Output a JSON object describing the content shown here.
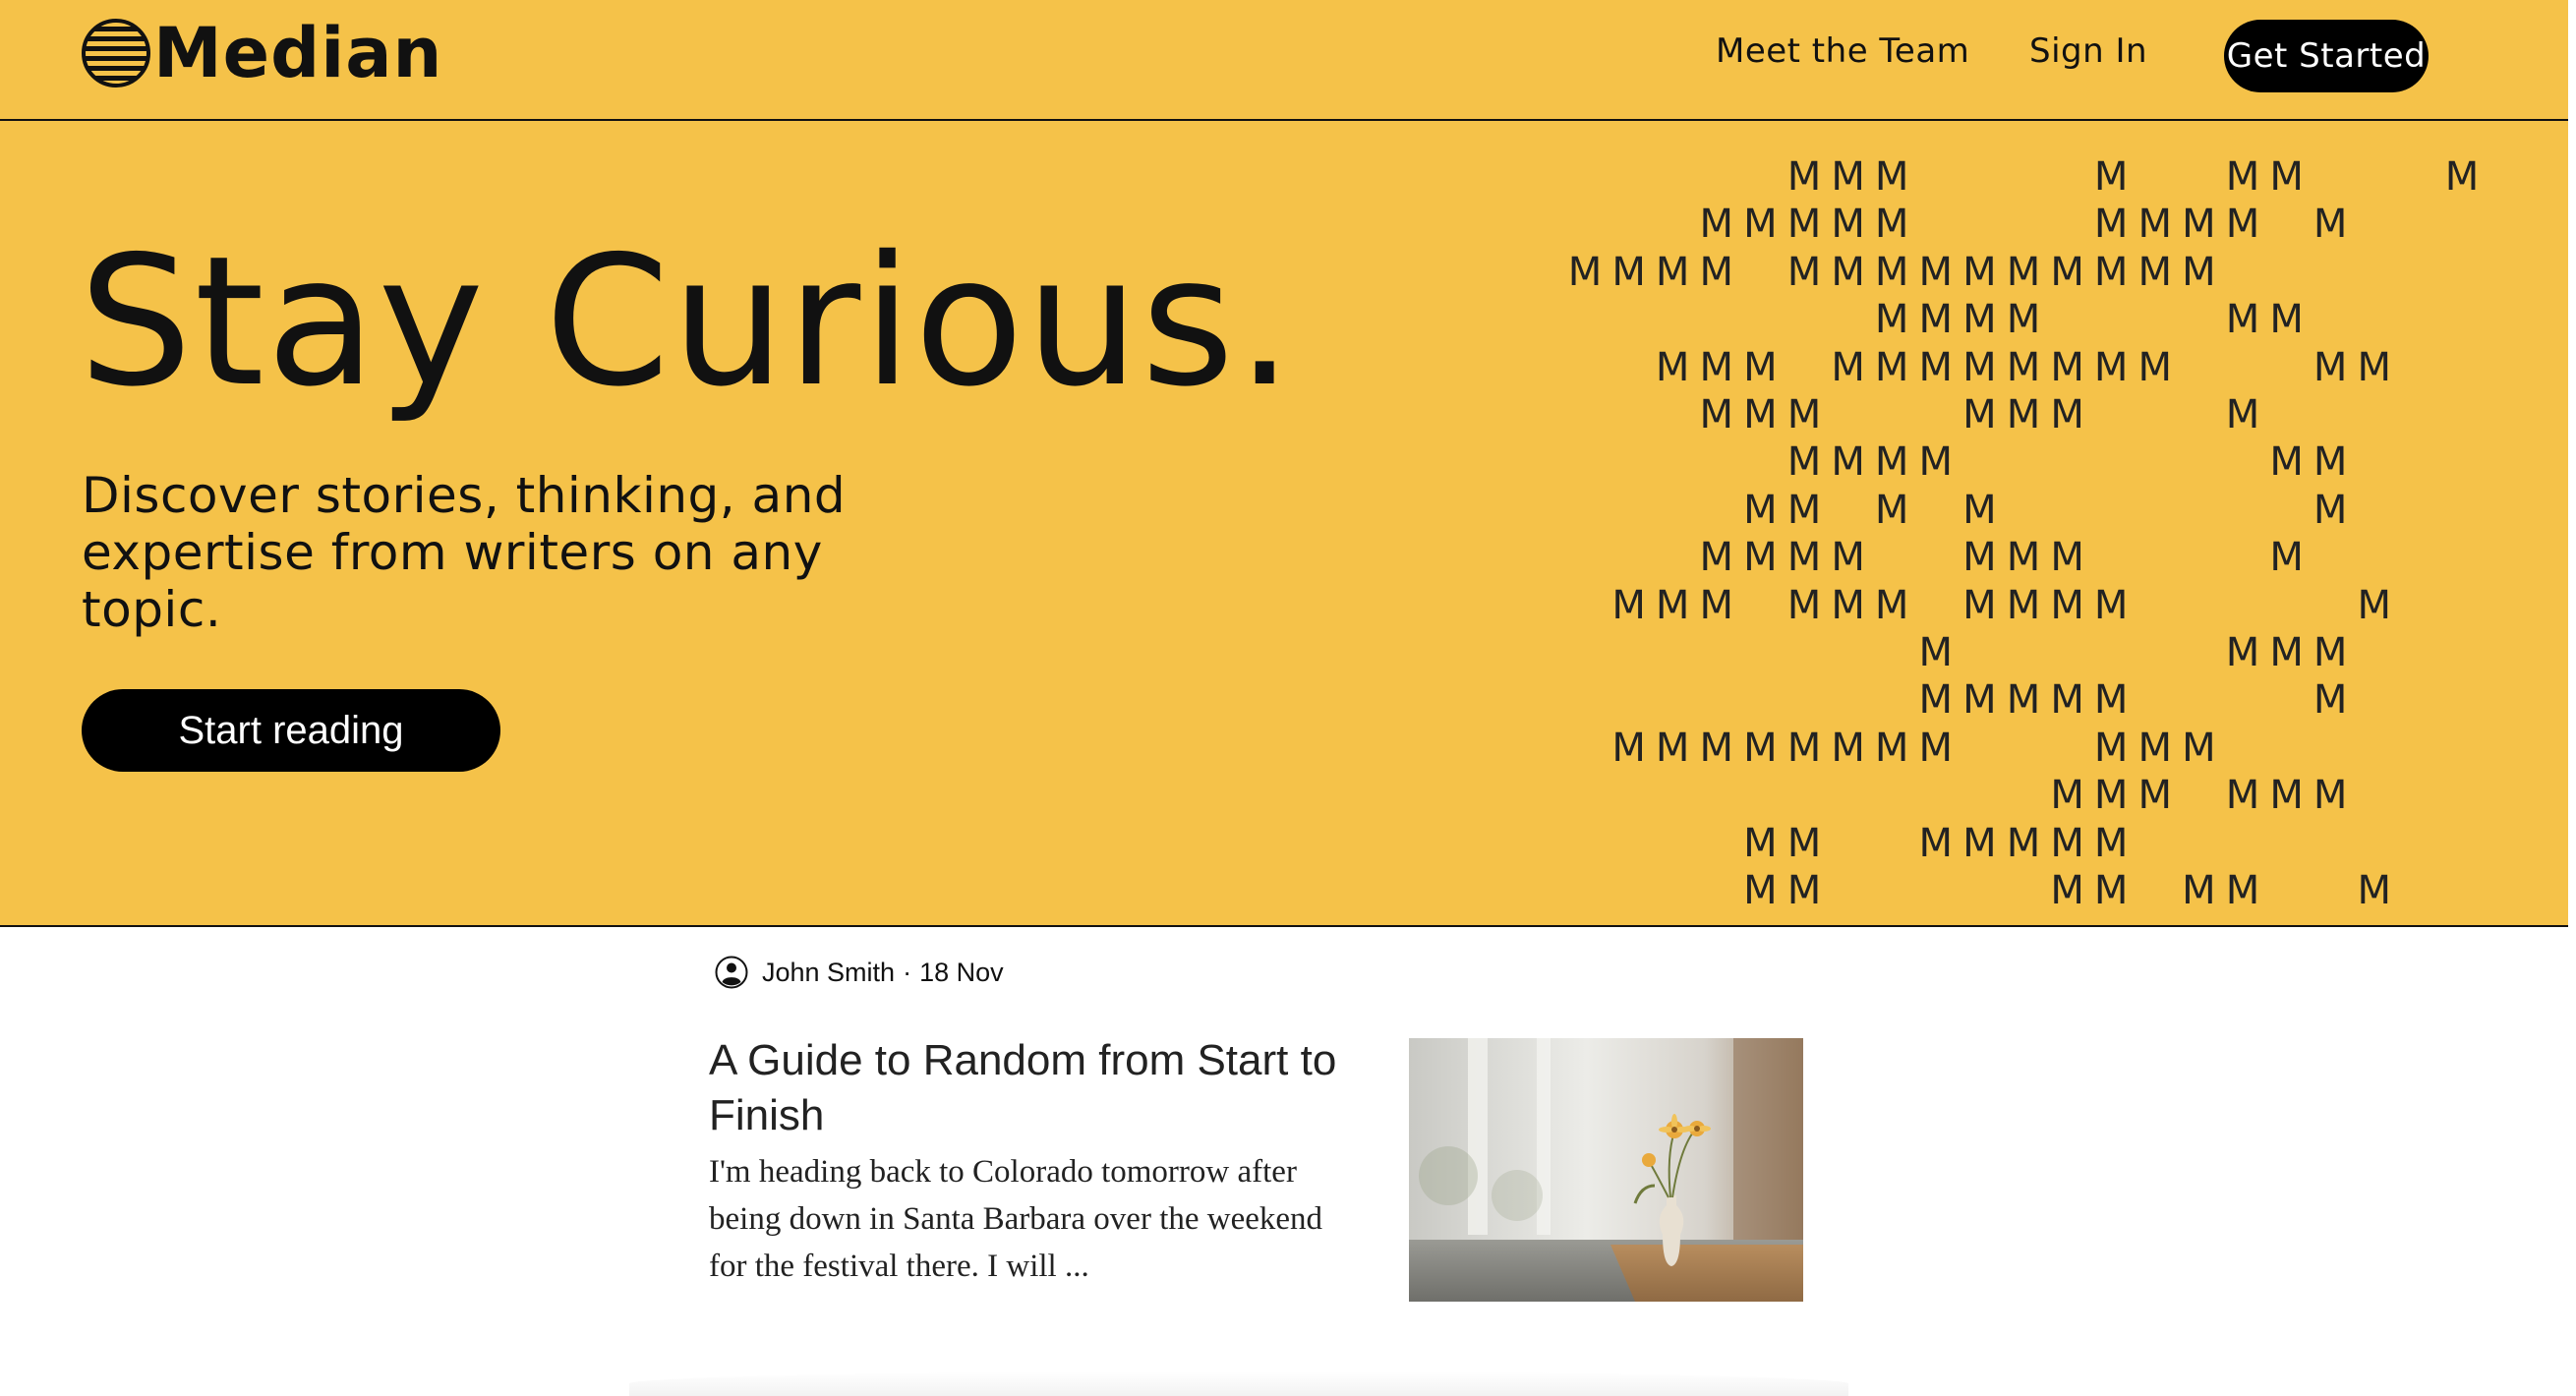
{
  "header": {
    "brand": "Median",
    "logo_icon": "striped-globe-icon",
    "nav": {
      "meet_team": "Meet the Team",
      "sign_in": "Sign In",
      "get_started": "Get Started"
    }
  },
  "hero": {
    "title": "Stay Curious.",
    "subtitle": "Discover stories, thinking, and expertise from writers on any topic.",
    "cta": "Start reading",
    "pattern_letter": "M"
  },
  "article": {
    "author_icon": "user-avatar-icon",
    "author": "John Smith",
    "separator": "·",
    "date": "18 Nov",
    "title": "A Guide to Random from Start to Finish",
    "excerpt": "I'm heading back to Colorado tomorrow after being down in Santa Barbara over the weekend for the festival there. I will ...",
    "thumbnail": "flower-vase-photo"
  },
  "colors": {
    "brand_yellow": "#f5c249",
    "black": "#000000",
    "white": "#ffffff"
  }
}
